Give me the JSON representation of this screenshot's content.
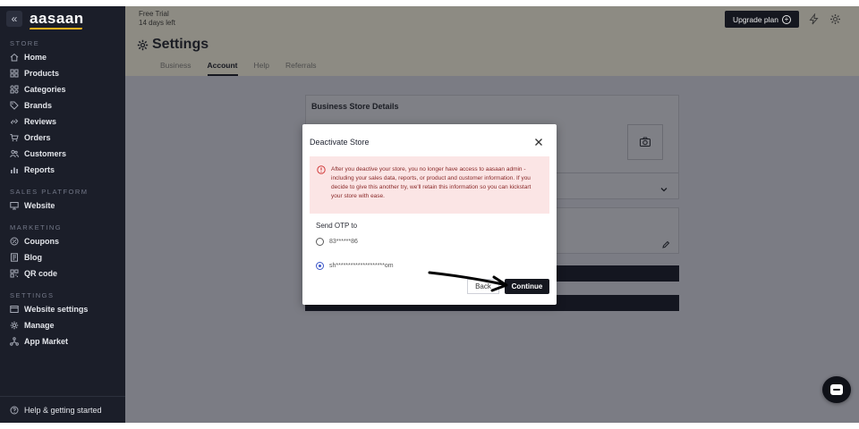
{
  "sidebar": {
    "brand": "aasaan",
    "collapse_glyph": "«",
    "sections": [
      {
        "label": "STORE",
        "items": [
          {
            "label": "Home",
            "icon": "home-icon"
          },
          {
            "label": "Products",
            "icon": "products-icon"
          },
          {
            "label": "Categories",
            "icon": "categories-icon"
          },
          {
            "label": "Brands",
            "icon": "brands-icon"
          },
          {
            "label": "Reviews",
            "icon": "reviews-icon"
          },
          {
            "label": "Orders",
            "icon": "orders-icon"
          },
          {
            "label": "Customers",
            "icon": "customers-icon"
          },
          {
            "label": "Reports",
            "icon": "reports-icon"
          }
        ]
      },
      {
        "label": "SALES PLATFORM",
        "items": [
          {
            "label": "Website",
            "icon": "website-icon"
          }
        ]
      },
      {
        "label": "MARKETING",
        "items": [
          {
            "label": "Coupons",
            "icon": "coupons-icon"
          },
          {
            "label": "Blog",
            "icon": "blog-icon"
          },
          {
            "label": "QR code",
            "icon": "qr-code-icon"
          }
        ]
      },
      {
        "label": "SETTINGS",
        "items": [
          {
            "label": "Website settings",
            "icon": "website-settings-icon"
          },
          {
            "label": "Manage",
            "icon": "manage-icon"
          },
          {
            "label": "App Market",
            "icon": "app-market-icon"
          }
        ]
      }
    ],
    "footer_label": "Help & getting started"
  },
  "topbar": {
    "trial_line1": "Free Trial",
    "trial_line2": "14 days left",
    "upgrade_label": "Upgrade plan",
    "upgrade_glyph": "+"
  },
  "page": {
    "title": "Settings",
    "tabs": [
      {
        "label": "Business",
        "active": false
      },
      {
        "label": "Account",
        "active": true
      },
      {
        "label": "Help",
        "active": false
      },
      {
        "label": "Referrals",
        "active": false
      }
    ],
    "card_title": "Business Store Details"
  },
  "modal": {
    "title": "Deactivate Store",
    "close_glyph": "✕",
    "alert_text": "After you deactive your store, you no longer have access to aasaan admin - including your sales data, reports, or product and customer information. If you decide to give this another try, we'll retain this information so you can kickstart your store with ease.",
    "otp_label": "Send OTP to",
    "options": [
      {
        "value": "83******86",
        "selected": false
      },
      {
        "value": "sh********************om",
        "selected": true
      }
    ],
    "back_label": "Back",
    "continue_label": "Continue"
  },
  "colors": {
    "sidebar_bg": "#1b1e29",
    "primary_dark": "#15171f",
    "brand_accent": "#f2b01e",
    "alert_bg": "#fbe5e5",
    "alert_text": "#8a2a2a",
    "radio_selected": "#3b56c8"
  }
}
